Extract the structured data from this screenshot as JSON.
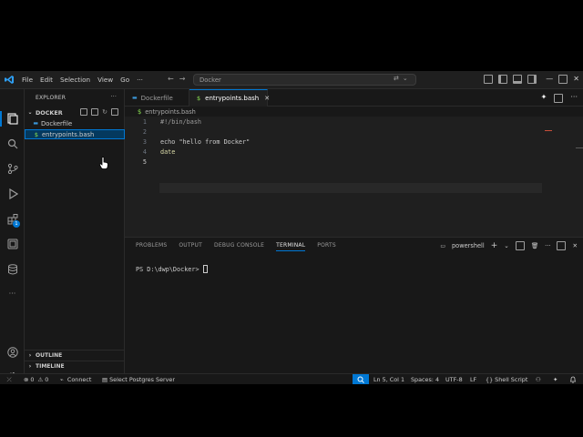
{
  "menu": {
    "file": "File",
    "edit": "Edit",
    "selection": "Selection",
    "view": "View",
    "go": "Go",
    "more": "···"
  },
  "command_center": {
    "text": "Docker"
  },
  "sidebar": {
    "title": "EXPLORER",
    "more": "···",
    "folder": "DOCKER",
    "files": [
      {
        "label": "Dockerfile"
      },
      {
        "label": "entrypoints.bash"
      }
    ],
    "outline": "OUTLINE",
    "timeline": "TIMELINE"
  },
  "activity": {
    "extensions_badge": "1"
  },
  "tabs": [
    {
      "label": "Dockerfile"
    },
    {
      "label": "entrypoints.bash",
      "close": "✕"
    }
  ],
  "breadcrumb": "entrypoints.bash",
  "editor": {
    "line_numbers": [
      "1",
      "2",
      "3",
      "4",
      "5"
    ],
    "lines": [
      "#!/bin/bash",
      "",
      "echo \"hello from Docker\"",
      "date",
      ""
    ]
  },
  "panel": {
    "tabs": [
      "PROBLEMS",
      "OUTPUT",
      "DEBUG CONSOLE",
      "TERMINAL",
      "PORTS"
    ],
    "active_tab": "TERMINAL",
    "shell": "powershell",
    "prompt": "PS D:\\dwp\\Docker>"
  },
  "status": {
    "errors": "0",
    "warnings": "0",
    "connect": "Connect",
    "server": "Select Postgres Server",
    "position": "Ln 5, Col 1",
    "spaces": "Spaces: 4",
    "encoding": "UTF-8",
    "eol": "LF",
    "language": "Shell Script"
  },
  "colors": {
    "accent": "#0078d4",
    "background": "#181818",
    "editor_bg": "#1f1f1f"
  }
}
